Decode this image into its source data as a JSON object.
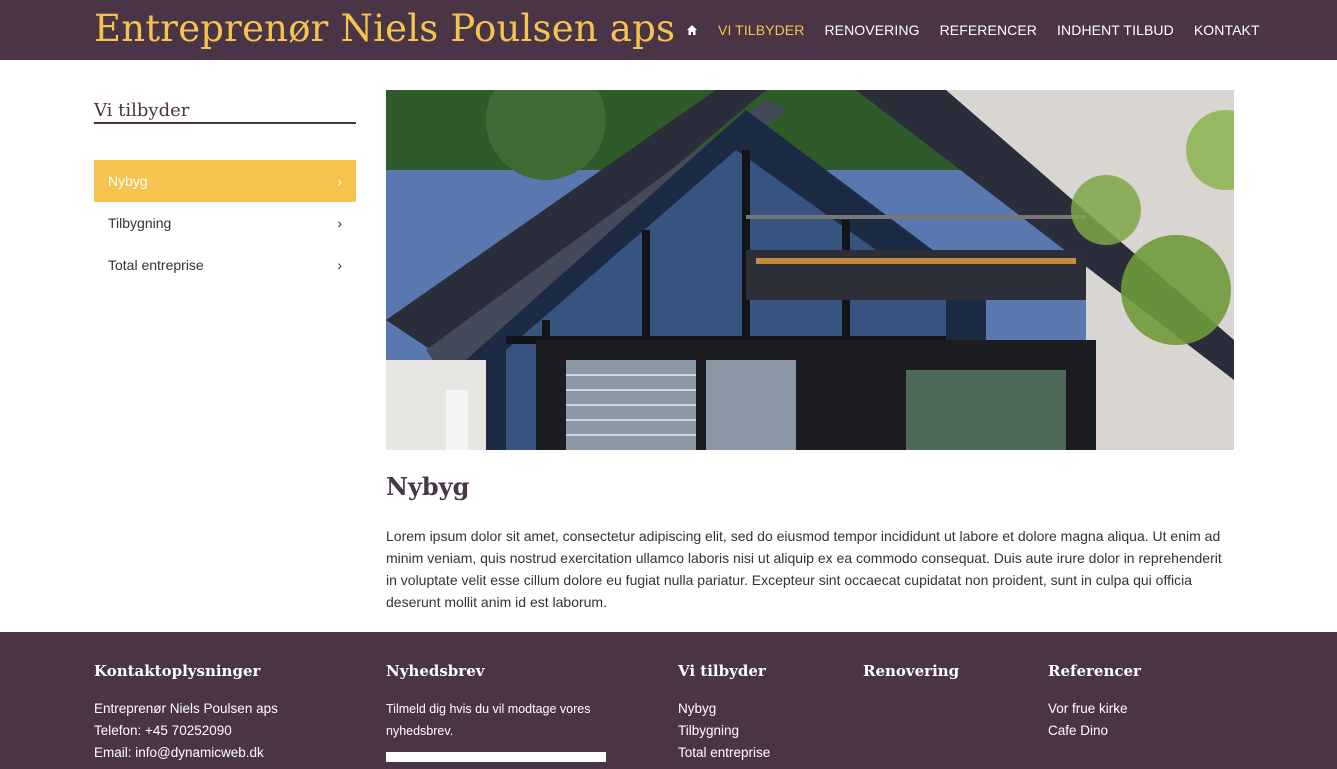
{
  "header": {
    "brand": "Entreprenør Niels Poulsen aps",
    "nav": [
      {
        "label": "VI TILBYDER",
        "active": true
      },
      {
        "label": "RENOVERING"
      },
      {
        "label": "REFERENCER"
      },
      {
        "label": "INDHENT TILBUD"
      },
      {
        "label": "KONTAKT"
      }
    ]
  },
  "sidebar": {
    "title": "Vi tilbyder",
    "items": [
      {
        "label": "Nybyg",
        "active": true
      },
      {
        "label": "Tilbygning"
      },
      {
        "label": "Total entreprise"
      }
    ]
  },
  "main": {
    "title": "Nybyg",
    "body": "Lorem ipsum dolor sit amet, consectetur adipiscing elit, sed do eiusmod tempor incididunt ut labore et dolore magna aliqua. Ut enim ad minim veniam, quis nostrud exercitation ullamco laboris nisi ut aliquip ex ea commodo consequat. Duis aute irure dolor in reprehenderit in voluptate velit esse cillum dolore eu fugiat nulla pariatur. Excepteur sint occaecat cupidatat non proident, sunt in culpa qui officia deserunt mollit anim id est laborum."
  },
  "footer": {
    "contact": {
      "title": "Kontaktoplysninger",
      "lines": [
        "Entreprenør Niels Poulsen aps",
        "Telefon: +45 70252090",
        "Email: info@dynamicweb.dk"
      ]
    },
    "newsletter": {
      "title": "Nyhedsbrev",
      "text": "Tilmeld dig hvis du vil modtage vores nyhedsbrev."
    },
    "offer": {
      "title": "Vi tilbyder",
      "links": [
        "Nybyg",
        "Tilbygning",
        "Total entreprise"
      ]
    },
    "renovation": {
      "title": "Renovering"
    },
    "references": {
      "title": "Referencer",
      "links": [
        "Vor frue kirke",
        "Cafe Dino"
      ]
    }
  },
  "colors": {
    "brand_purple": "#4a3546",
    "accent_yellow": "#f6c34e"
  },
  "icons": {
    "home": "home-icon",
    "chevron": "chevron-right-icon"
  }
}
